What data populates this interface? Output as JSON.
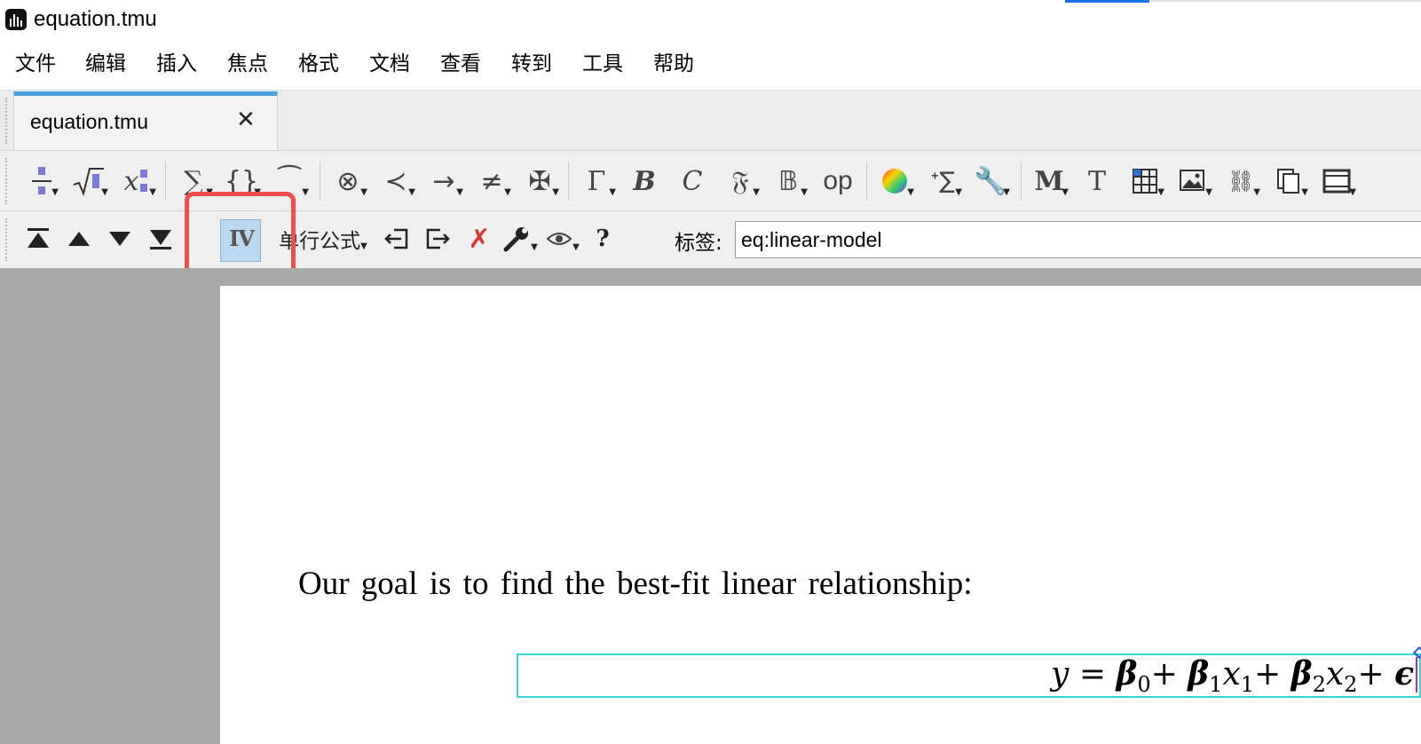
{
  "window": {
    "title": "equation.tmu"
  },
  "menu": [
    "文件",
    "编辑",
    "插入",
    "焦点",
    "格式",
    "文档",
    "查看",
    "转到",
    "工具",
    "帮助"
  ],
  "tab": {
    "label": "equation.tmu",
    "close": "✕"
  },
  "toolbar1": {
    "icons": [
      "fraction-icon",
      "sqrt-icon",
      "subscript-icon",
      "sum-icon",
      "braces-icon",
      "tilde-icon",
      "otimes-icon",
      "prec-icon",
      "arrow-icon",
      "neq-icon",
      "maltese-icon",
      "greek-icon",
      "bold-icon",
      "calligraphic-icon",
      "fraktur-icon",
      "blackboard-icon",
      "operator-icon",
      "color-wheel-icon",
      "sum-style-icon",
      "tools-sum-icon",
      "math-icon",
      "text-icon",
      "table-icon",
      "image-icon",
      "link-icon",
      "copy-icon",
      "film-icon"
    ],
    "labels": {
      "op": "op",
      "T": "T",
      "B": "B",
      "C": "C"
    }
  },
  "toolbar2": {
    "mode_label": "单行公式",
    "numbering_label": "IV",
    "label_caption": "标签:",
    "label_value": "eq:linear-model",
    "help": "?"
  },
  "document": {
    "paragraph": "Our goal is to find the best-fit linear relationship:",
    "equation": {
      "y": "y",
      "eq": "=",
      "beta": "β",
      "sub0": "0",
      "plus": "+",
      "sub1": "1",
      "x": "x",
      "sub2": "2",
      "eps": "ϵ"
    }
  },
  "colors": {
    "accent": "#4aa3df",
    "highlight": "#bcd8ef",
    "callout": "#ee4d4d",
    "equation_border": "#35d7d7"
  }
}
